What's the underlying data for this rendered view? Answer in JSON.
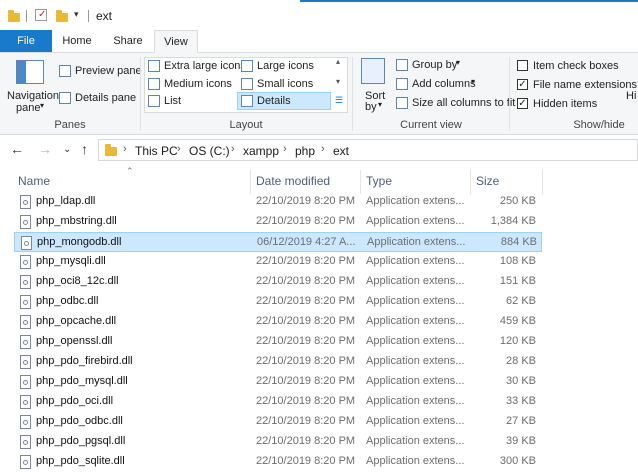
{
  "window": {
    "title": "ext"
  },
  "tabs": [
    "File",
    "Home",
    "Share",
    "View"
  ],
  "ribbon": {
    "panes": {
      "navigation_pane_line1": "Navigation",
      "navigation_pane_line2": "pane",
      "preview_pane": "Preview pane",
      "details_pane": "Details pane",
      "label": "Panes"
    },
    "layout": {
      "items": [
        "Extra large icons",
        "Large icons",
        "Medium icons",
        "Small icons",
        "List",
        "Details"
      ],
      "selected": "Details",
      "label": "Layout"
    },
    "current_view": {
      "sort_line1": "Sort",
      "sort_line2": "by",
      "group_by": "Group by",
      "add_columns": "Add columns",
      "size_all_columns": "Size all columns to fit",
      "label": "Current view"
    },
    "show_hide": {
      "item_check_boxes": {
        "label": "Item check boxes",
        "checked": false
      },
      "file_name_extensions": {
        "label": "File name extensions",
        "checked": true
      },
      "hidden_items": {
        "label": "Hidden items",
        "checked": true
      },
      "hide_partial": "Hi",
      "label": "Show/hide"
    }
  },
  "address": {
    "crumbs": [
      "This PC",
      "OS (C:)",
      "xampp",
      "php",
      "ext"
    ]
  },
  "columns": {
    "name": "Name",
    "date": "Date modified",
    "type": "Type",
    "size": "Size"
  },
  "files": [
    {
      "name": "php_ldap.dll",
      "date": "22/10/2019 8:20 PM",
      "type": "Application extens...",
      "size": "250 KB",
      "selected": false
    },
    {
      "name": "php_mbstring.dll",
      "date": "22/10/2019 8:20 PM",
      "type": "Application extens...",
      "size": "1,384 KB",
      "selected": false
    },
    {
      "name": "php_mongodb.dll",
      "date": "06/12/2019 4:27 A...",
      "type": "Application extens...",
      "size": "884 KB",
      "selected": true
    },
    {
      "name": "php_mysqli.dll",
      "date": "22/10/2019 8:20 PM",
      "type": "Application extens...",
      "size": "108 KB",
      "selected": false
    },
    {
      "name": "php_oci8_12c.dll",
      "date": "22/10/2019 8:20 PM",
      "type": "Application extens...",
      "size": "151 KB",
      "selected": false
    },
    {
      "name": "php_odbc.dll",
      "date": "22/10/2019 8:20 PM",
      "type": "Application extens...",
      "size": "62 KB",
      "selected": false
    },
    {
      "name": "php_opcache.dll",
      "date": "22/10/2019 8:20 PM",
      "type": "Application extens...",
      "size": "459 KB",
      "selected": false
    },
    {
      "name": "php_openssl.dll",
      "date": "22/10/2019 8:20 PM",
      "type": "Application extens...",
      "size": "120 KB",
      "selected": false
    },
    {
      "name": "php_pdo_firebird.dll",
      "date": "22/10/2019 8:20 PM",
      "type": "Application extens...",
      "size": "28 KB",
      "selected": false
    },
    {
      "name": "php_pdo_mysql.dll",
      "date": "22/10/2019 8:20 PM",
      "type": "Application extens...",
      "size": "30 KB",
      "selected": false
    },
    {
      "name": "php_pdo_oci.dll",
      "date": "22/10/2019 8:20 PM",
      "type": "Application extens...",
      "size": "33 KB",
      "selected": false
    },
    {
      "name": "php_pdo_odbc.dll",
      "date": "22/10/2019 8:20 PM",
      "type": "Application extens...",
      "size": "27 KB",
      "selected": false
    },
    {
      "name": "php_pdo_pgsql.dll",
      "date": "22/10/2019 8:20 PM",
      "type": "Application extens...",
      "size": "39 KB",
      "selected": false
    },
    {
      "name": "php_pdo_sqlite.dll",
      "date": "22/10/2019 8:20 PM",
      "type": "Application extens...",
      "size": "300 KB",
      "selected": false
    }
  ],
  "colors": {
    "accent": "#1979ca",
    "selection": "#cce8ff",
    "selection_border": "#99d1ff"
  }
}
